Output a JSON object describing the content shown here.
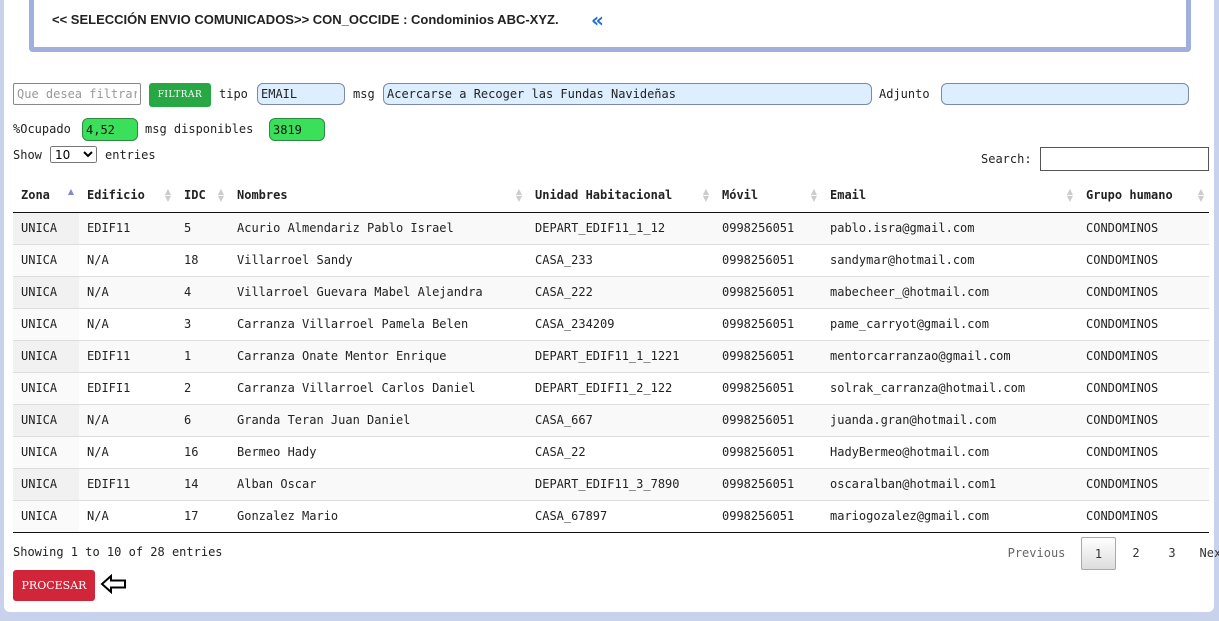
{
  "header": {
    "title": "<< SELECCIÓN ENVIO COMUNICADOS>> CON_OCCIDE : Condominios ABC-XYZ.",
    "back_icon": "double-chevron-left-icon"
  },
  "filters": {
    "filter_placeholder": "Que desea filtrar",
    "filter_button": "FILTRAR",
    "tipo_label": "tipo",
    "tipo_value": "EMAIL",
    "msg_label": "msg",
    "msg_value": "Acercarse a Recoger las Fundas Navideñas",
    "adjunto_label": "Adjunto",
    "adjunto_value": ""
  },
  "stats": {
    "ocupado_label": "%Ocupado",
    "ocupado_value": "4,52",
    "disponibles_label": "msg disponibles",
    "disponibles_value": "3819"
  },
  "length_menu": {
    "show_label": "Show",
    "selected": "10",
    "entries_label": "entries"
  },
  "search": {
    "label": "Search:",
    "value": ""
  },
  "table": {
    "columns": [
      "Zona",
      "Edificio",
      "IDC",
      "Nombres",
      "Unidad Habitacional",
      "Móvil",
      "Email",
      "Grupo humano"
    ],
    "rows": [
      [
        "UNICA",
        "EDIF11",
        "5",
        "Acurio Almendariz Pablo Israel",
        "DEPART_EDIF11_1_12",
        "0998256051",
        "pablo.isra@gmail.com",
        "CONDOMINOS"
      ],
      [
        "UNICA",
        "N/A",
        "18",
        "Villarroel Sandy",
        "CASA_233",
        "0998256051",
        "sandymar@hotmail.com",
        "CONDOMINOS"
      ],
      [
        "UNICA",
        "N/A",
        "4",
        "Villarroel Guevara Mabel Alejandra",
        "CASA_222",
        "0998256051",
        "mabecheer_@hotmail.com",
        "CONDOMINOS"
      ],
      [
        "UNICA",
        "N/A",
        "3",
        "Carranza Villarroel Pamela Belen",
        "CASA_234209",
        "0998256051",
        "pame_carryot@gmail.com",
        "CONDOMINOS"
      ],
      [
        "UNICA",
        "EDIF11",
        "1",
        "Carranza Onate Mentor Enrique",
        "DEPART_EDIF11_1_1221",
        "0998256051",
        "mentorcarranzao@gmail.com",
        "CONDOMINOS"
      ],
      [
        "UNICA",
        "EDIFI1",
        "2",
        "Carranza Villarroel Carlos Daniel",
        "DEPART_EDIFI1_2_122",
        "0998256051",
        "solrak_carranza@hotmail.com",
        "CONDOMINOS"
      ],
      [
        "UNICA",
        "N/A",
        "6",
        "Granda Teran Juan Daniel",
        "CASA_667",
        "0998256051",
        "juanda.gran@hotmail.com",
        "CONDOMINOS"
      ],
      [
        "UNICA",
        "N/A",
        "16",
        "Bermeo Hady",
        "CASA_22",
        "0998256051",
        "HadyBermeo@hotmail.com",
        "CONDOMINOS"
      ],
      [
        "UNICA",
        "EDIF11",
        "14",
        "Alban Oscar",
        "DEPART_EDIF11_3_7890",
        "0998256051",
        "oscaralban@hotmail.com1",
        "CONDOMINOS"
      ],
      [
        "UNICA",
        "N/A",
        "17",
        "Gonzalez Mario",
        "CASA_67897",
        "0998256051",
        "mariogozalez@gmail.com",
        "CONDOMINOS"
      ]
    ]
  },
  "footer": {
    "info": "Showing 1 to 10 of 28 entries",
    "previous": "Previous",
    "pages": [
      "1",
      "2",
      "3"
    ],
    "next": "Next",
    "procesar_button": "PROCESAR",
    "procesar_arrow_icon": "arrow-left-outline-icon"
  },
  "colors": {
    "accent_blue": "#1e6fd9",
    "filter_green": "#28a745",
    "stat_green": "#3be05a",
    "procesar_red": "#d1253a",
    "field_blue": "#ddeeff"
  }
}
